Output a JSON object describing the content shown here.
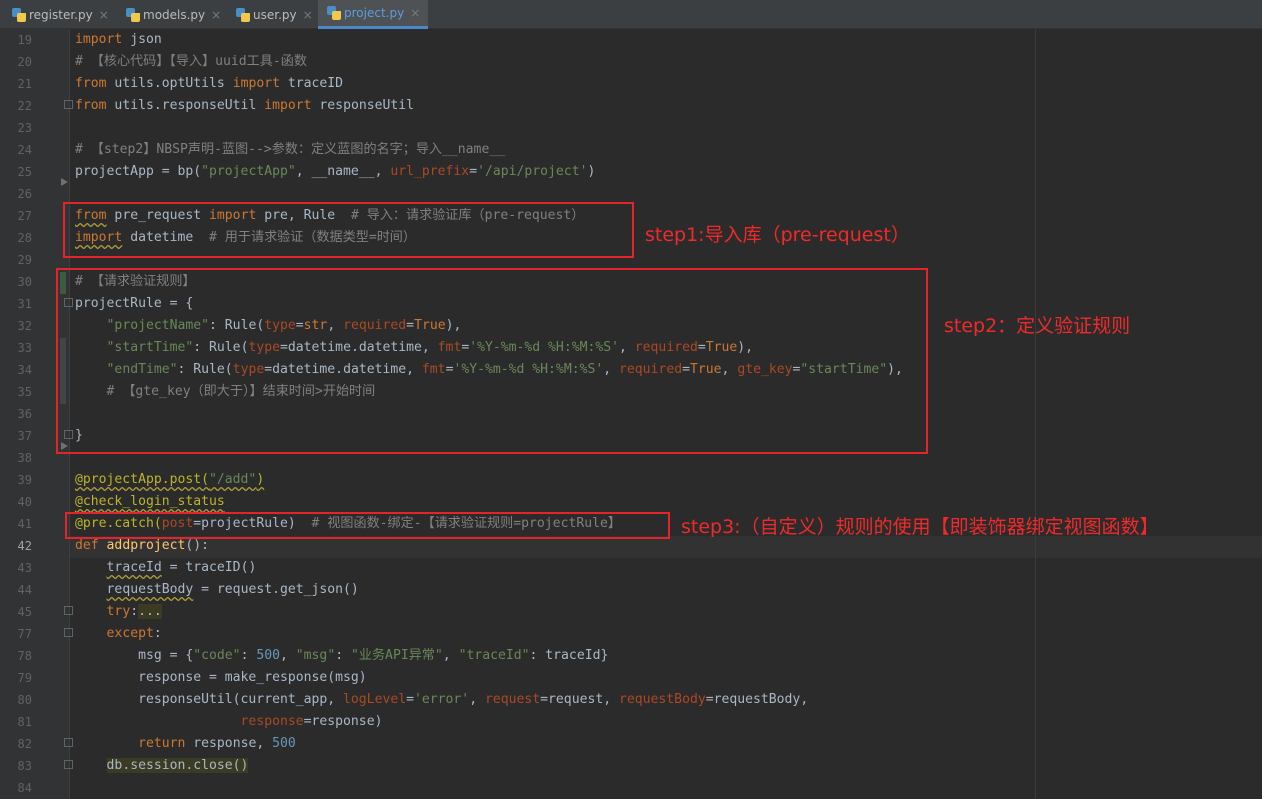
{
  "tabs": [
    {
      "label": "register.py",
      "active": false
    },
    {
      "label": "models.py",
      "active": false
    },
    {
      "label": "user.py",
      "active": false
    },
    {
      "label": "project.py",
      "active": true
    }
  ],
  "close_glyph": "×",
  "current_line": "42",
  "lines": [
    {
      "n": "19",
      "seg": [
        [
          "kw",
          "import"
        ],
        [
          "",
          " json"
        ]
      ]
    },
    {
      "n": "20",
      "seg": [
        [
          "cm",
          "# 【核心代码】【导入】uuid工具-函数"
        ]
      ]
    },
    {
      "n": "21",
      "seg": [
        [
          "kw",
          "from"
        ],
        [
          "",
          " utils.optUtils "
        ],
        [
          "kw",
          "import"
        ],
        [
          "",
          " traceID"
        ]
      ]
    },
    {
      "n": "22",
      "seg": [
        [
          "kw",
          "from"
        ],
        [
          "",
          " utils.responseUtil "
        ],
        [
          "kw",
          "import"
        ],
        [
          "",
          " responseUtil"
        ]
      ]
    },
    {
      "n": "23",
      "seg": []
    },
    {
      "n": "24",
      "seg": [
        [
          "cm",
          "# 【step2】NBSP声明-蓝图-->参数：定义蓝图的名字；导入__name__"
        ]
      ]
    },
    {
      "n": "25",
      "seg": [
        [
          "",
          "projectApp = bp("
        ],
        [
          "str",
          "\"projectApp\""
        ],
        [
          "",
          ", __name__, "
        ],
        [
          "prm",
          "url_prefix"
        ],
        [
          "",
          "="
        ],
        [
          "str",
          "'/api/project'"
        ],
        [
          "",
          ")"
        ]
      ]
    },
    {
      "n": "26",
      "seg": []
    },
    {
      "n": "27",
      "seg": [
        [
          "kw und",
          "from"
        ],
        [
          "",
          " pre_request "
        ],
        [
          "kw",
          "import"
        ],
        [
          "",
          " pre, Rule  "
        ],
        [
          "cm",
          "# 导入：请求验证库（pre-request）"
        ]
      ]
    },
    {
      "n": "28",
      "seg": [
        [
          "kw und",
          "import"
        ],
        [
          "",
          " datetime  "
        ],
        [
          "cm",
          "# 用于请求验证（数据类型=时间）"
        ]
      ]
    },
    {
      "n": "29",
      "seg": []
    },
    {
      "n": "30",
      "seg": [
        [
          "cm",
          "# 【请求验证规则】"
        ]
      ]
    },
    {
      "n": "31",
      "seg": [
        [
          "",
          "projectRule = {"
        ]
      ]
    },
    {
      "n": "32",
      "seg": [
        [
          "",
          "    "
        ],
        [
          "str",
          "\"projectName\""
        ],
        [
          "",
          ": Rule("
        ],
        [
          "prm",
          "type"
        ],
        [
          "",
          "="
        ],
        [
          "kw",
          "str"
        ],
        [
          "",
          ", "
        ],
        [
          "prm",
          "required"
        ],
        [
          "",
          "="
        ],
        [
          "kw",
          "True"
        ],
        [
          "",
          "),"
        ]
      ]
    },
    {
      "n": "33",
      "seg": [
        [
          "",
          "    "
        ],
        [
          "str",
          "\"startTime\""
        ],
        [
          "",
          ": Rule("
        ],
        [
          "prm",
          "type"
        ],
        [
          "",
          "=datetime.datetime, "
        ],
        [
          "prm",
          "fmt"
        ],
        [
          "",
          "="
        ],
        [
          "str",
          "'%Y-%m-%d %H:%M:%S'"
        ],
        [
          "",
          ", "
        ],
        [
          "prm",
          "required"
        ],
        [
          "",
          "="
        ],
        [
          "kw",
          "True"
        ],
        [
          "",
          "),"
        ]
      ]
    },
    {
      "n": "34",
      "seg": [
        [
          "",
          "    "
        ],
        [
          "str",
          "\"endTime\""
        ],
        [
          "",
          ": Rule("
        ],
        [
          "prm",
          "type"
        ],
        [
          "",
          "=datetime.datetime, "
        ],
        [
          "prm",
          "fmt"
        ],
        [
          "",
          "="
        ],
        [
          "str",
          "'%Y-%m-%d %H:%M:%S'"
        ],
        [
          "",
          ", "
        ],
        [
          "prm",
          "required"
        ],
        [
          "",
          "="
        ],
        [
          "kw",
          "True"
        ],
        [
          "",
          ", "
        ],
        [
          "prm",
          "gte_key"
        ],
        [
          "",
          "="
        ],
        [
          "str",
          "\"startTime\""
        ],
        [
          "",
          "),"
        ]
      ]
    },
    {
      "n": "35",
      "seg": [
        [
          "",
          "    "
        ],
        [
          "cm",
          "# 【gte_key（即大于）】结束时间>开始时间"
        ]
      ]
    },
    {
      "n": "36",
      "seg": []
    },
    {
      "n": "37",
      "seg": [
        [
          "",
          "}"
        ]
      ]
    },
    {
      "n": "38",
      "seg": []
    },
    {
      "n": "39",
      "seg": [
        [
          "dec und",
          "@projectApp.post("
        ],
        [
          "str und",
          "\"/add\""
        ],
        [
          "dec und",
          ")"
        ]
      ]
    },
    {
      "n": "40",
      "seg": [
        [
          "dec und",
          "@check_login_status"
        ]
      ]
    },
    {
      "n": "41",
      "seg": [
        [
          "dec",
          "@pre.catch("
        ],
        [
          "prm",
          "post"
        ],
        [
          "",
          "=projectRule)  "
        ],
        [
          "cm",
          "# 视图函数-绑定-【请求验证规则=projectRule】"
        ]
      ]
    },
    {
      "n": "42",
      "seg": [
        [
          "kw",
          "def "
        ],
        [
          "fn",
          "addproject"
        ],
        [
          "",
          "():"
        ]
      ]
    },
    {
      "n": "43",
      "seg": [
        [
          "",
          "    "
        ],
        [
          "und",
          "traceId"
        ],
        [
          "",
          " = traceID()"
        ]
      ]
    },
    {
      "n": "44",
      "seg": [
        [
          "",
          "    "
        ],
        [
          "und",
          "requestBody"
        ],
        [
          "",
          " = request.get_json()"
        ]
      ]
    },
    {
      "n": "45",
      "seg": [
        [
          "",
          "    "
        ],
        [
          "kw",
          "try"
        ],
        [
          "",
          ":"
        ],
        [
          "hl",
          "..."
        ]
      ]
    },
    {
      "n": "77",
      "seg": [
        [
          "",
          "    "
        ],
        [
          "kw",
          "except"
        ],
        [
          "",
          ":"
        ]
      ]
    },
    {
      "n": "78",
      "seg": [
        [
          "",
          "        msg = {"
        ],
        [
          "str",
          "\"code\""
        ],
        [
          "",
          ": "
        ],
        [
          "num",
          "500"
        ],
        [
          "",
          ", "
        ],
        [
          "str",
          "\"msg\""
        ],
        [
          "",
          ": "
        ],
        [
          "str",
          "\"业务API异常\""
        ],
        [
          "",
          ", "
        ],
        [
          "str",
          "\"traceId\""
        ],
        [
          "",
          ": traceId}"
        ]
      ]
    },
    {
      "n": "79",
      "seg": [
        [
          "",
          "        response = make_response(msg)"
        ]
      ]
    },
    {
      "n": "80",
      "seg": [
        [
          "",
          "        responseUtil(current_app, "
        ],
        [
          "prm",
          "logLevel"
        ],
        [
          "",
          "="
        ],
        [
          "str",
          "'error'"
        ],
        [
          "",
          ", "
        ],
        [
          "prm",
          "request"
        ],
        [
          "",
          "=request, "
        ],
        [
          "prm",
          "requestBody"
        ],
        [
          "",
          "=requestBody,"
        ]
      ]
    },
    {
      "n": "81",
      "seg": [
        [
          "",
          "                     "
        ],
        [
          "prm",
          "response"
        ],
        [
          "",
          "=response)"
        ]
      ]
    },
    {
      "n": "82",
      "seg": [
        [
          "",
          "        "
        ],
        [
          "kw",
          "return"
        ],
        [
          "",
          " response, "
        ],
        [
          "num",
          "500"
        ]
      ]
    },
    {
      "n": "83",
      "seg": [
        [
          "",
          "    "
        ],
        [
          "hl",
          "db.session.close()"
        ]
      ]
    },
    {
      "n": "84",
      "seg": []
    }
  ],
  "annotations": {
    "step1": "step1:导入库（pre-request）",
    "step2": "step2：定义验证规则",
    "step3": "step3:（自定义）规则的使用【即装饰器绑定视图函数】"
  },
  "colors": {
    "annotation": "#e5232a",
    "background": "#2b2b2b",
    "keyword": "#cc7832",
    "string": "#6a8759",
    "comment": "#808080"
  }
}
